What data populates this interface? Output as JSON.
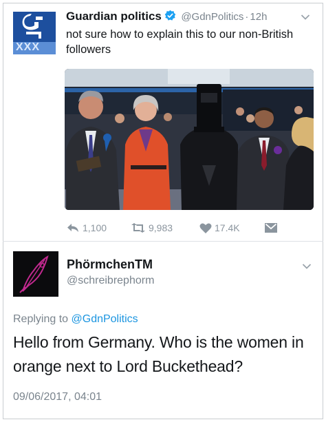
{
  "tweet1": {
    "author_name": "Guardian politics",
    "author_handle": "@GdnPolitics",
    "separator": "·",
    "time_ago": "12h",
    "text": "not sure how to explain this to our non-British followers",
    "avatar_icon": "guardian-logo-icon",
    "avatar_strip_text": "XXX",
    "actions": {
      "reply_count": "1,100",
      "retweet_count": "9,983",
      "like_count": "17.4K"
    }
  },
  "tweet2": {
    "author_name": "PhörmchenTM",
    "author_handle": "@schreibrephorm",
    "replying_prefix": "Replying to",
    "replying_to": "@GdnPolitics",
    "text": "Hello from Germany. Who is the women in orange next to Lord Buckethead?",
    "timestamp": "09/06/2017, 04:01"
  },
  "colors": {
    "link_blue": "#1b95e0",
    "muted_gray": "#7a848d",
    "verified_blue": "#1da1f2",
    "guardian_blue": "#1d4f9e",
    "orange_suit": "#e0502a"
  }
}
